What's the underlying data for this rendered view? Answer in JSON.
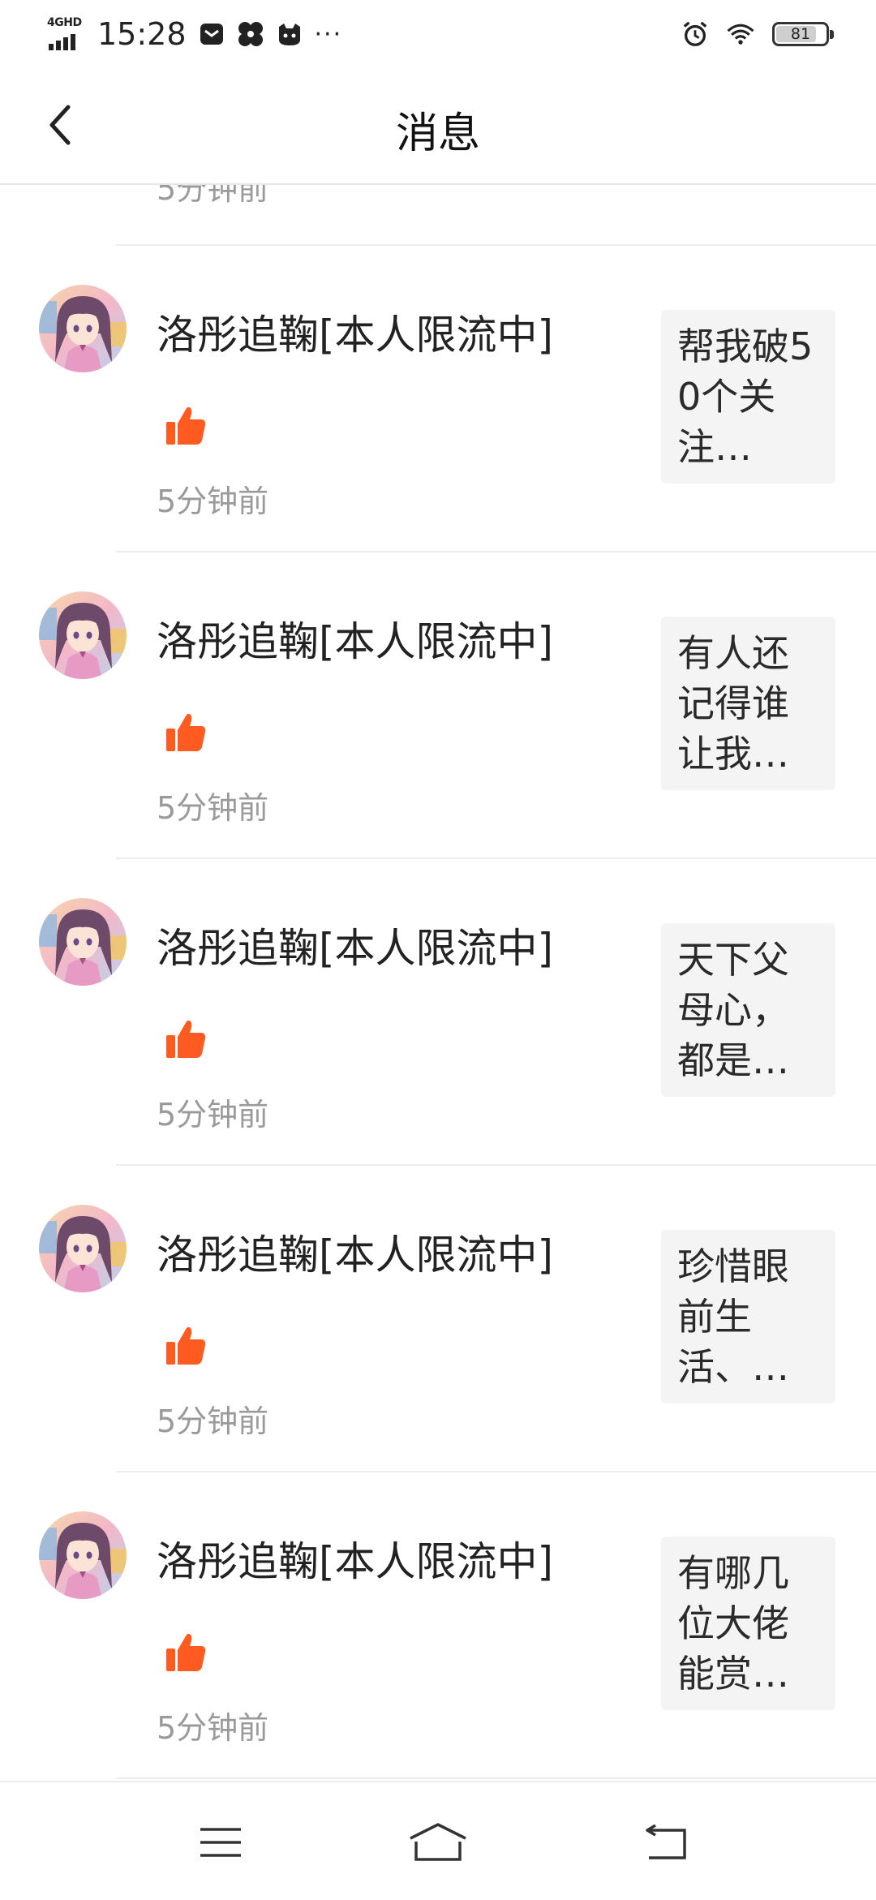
{
  "status_bar": {
    "network": "4GHD",
    "time": "15:28",
    "icons": [
      "message-icon",
      "pinwheel-icon",
      "cat-icon",
      "more-dots-icon",
      "alarm-icon",
      "wifi-icon",
      "battery-icon"
    ],
    "more": "···",
    "battery_level": "81",
    "battery_fraction": 0.81
  },
  "header": {
    "title": "消息",
    "back_icon": "chevron-left-icon"
  },
  "partial_item": {
    "time": "5分钟前"
  },
  "items": [
    {
      "username": "洛彤追鞠[本人限流中]",
      "action_icon": "thumbs-up-icon",
      "time": "5分钟前",
      "preview": "帮我破50个关注…"
    },
    {
      "username": "洛彤追鞠[本人限流中]",
      "action_icon": "thumbs-up-icon",
      "time": "5分钟前",
      "preview": "有人还记得谁让我…"
    },
    {
      "username": "洛彤追鞠[本人限流中]",
      "action_icon": "thumbs-up-icon",
      "time": "5分钟前",
      "preview": "天下父母心，都是…"
    },
    {
      "username": "洛彤追鞠[本人限流中]",
      "action_icon": "thumbs-up-icon",
      "time": "5分钟前",
      "preview": "珍惜眼前生活、…"
    },
    {
      "username": "洛彤追鞠[本人限流中]",
      "action_icon": "thumbs-up-icon",
      "time": "5分钟前",
      "preview": "有哪几位大佬能赏…"
    }
  ],
  "colors": {
    "accent": "#ff5a1f",
    "muted_text": "#9a9a9a",
    "card_bg": "#f4f4f4"
  },
  "nav_bar": {
    "icons": [
      "menu-icon",
      "home-icon",
      "back-icon"
    ]
  }
}
